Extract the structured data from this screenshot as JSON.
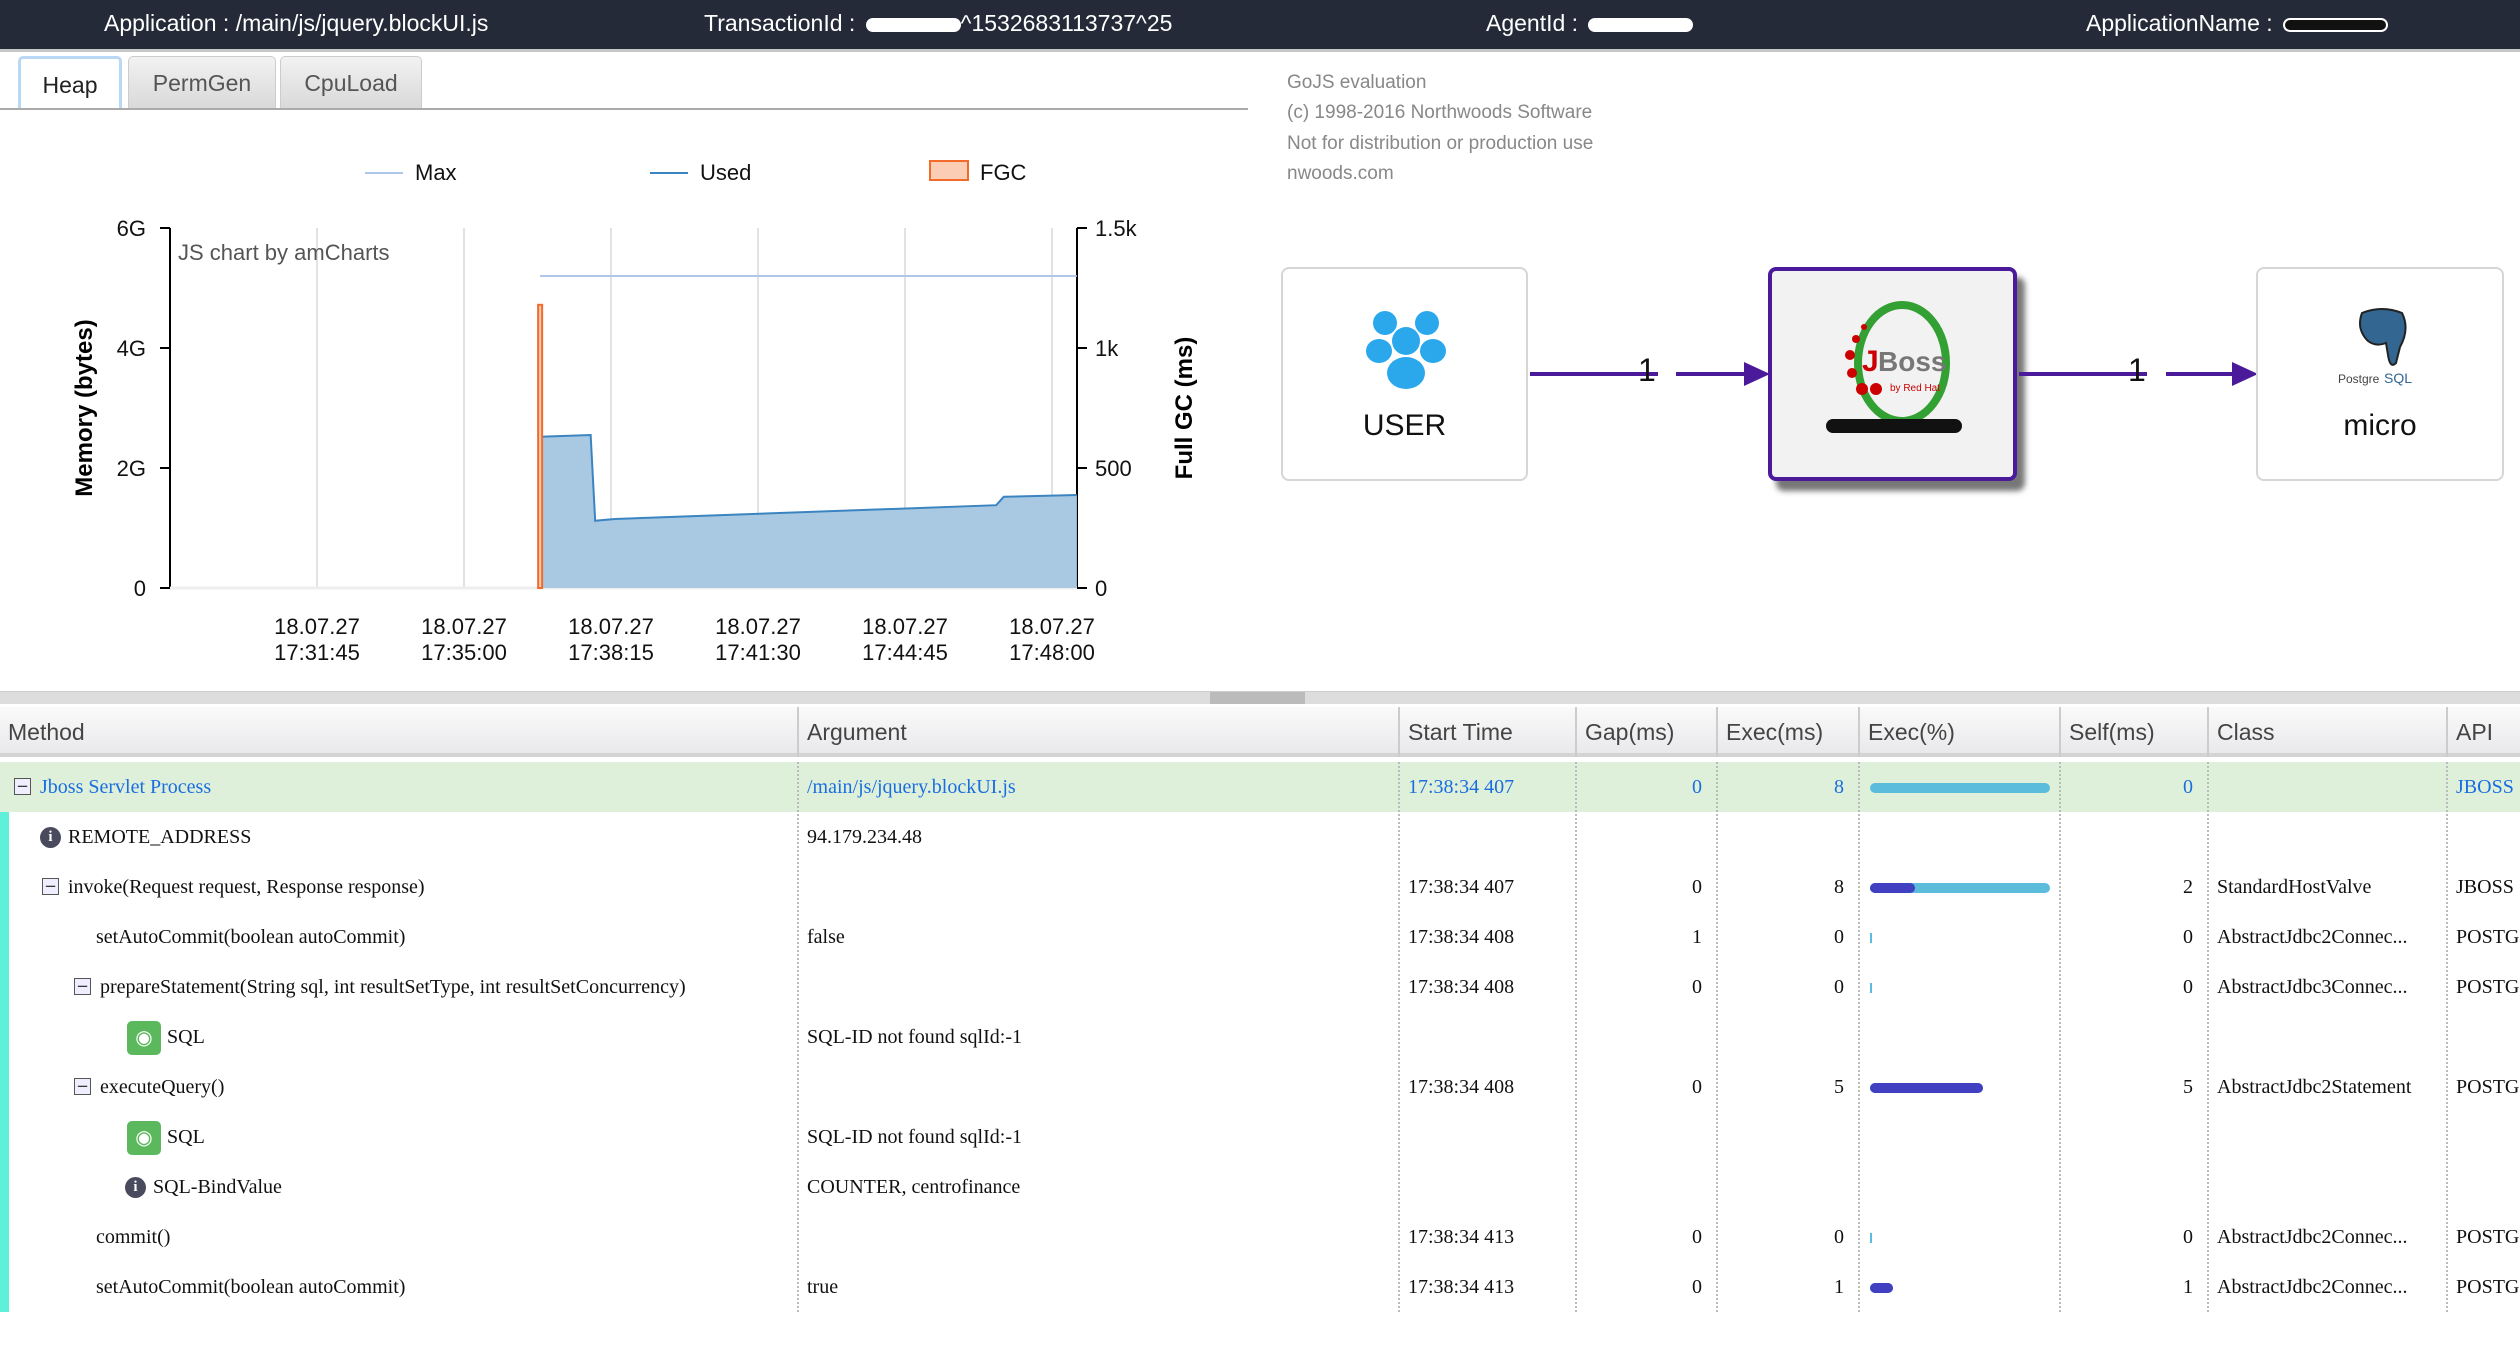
{
  "header": {
    "application_label": "Application : ",
    "application": "/main/js/jquery.blockUI.js",
    "transaction_label": "TransactionId : ",
    "transaction": "^1532683113737^25",
    "agent_label": "AgentId : ",
    "appname_label": "ApplicationName : "
  },
  "tabs": [
    {
      "label": "Heap",
      "active": true
    },
    {
      "label": "PermGen"
    },
    {
      "label": "CpuLoad"
    }
  ],
  "chart_data": {
    "type": "area",
    "watermark": "JS chart by amCharts",
    "ylabel": "Memory (bytes)",
    "y2label": "Full GC (ms)",
    "y_ticks": [
      "0",
      "2G",
      "4G",
      "6G"
    ],
    "y_range_gb": [
      0,
      6
    ],
    "y2_ticks": [
      "0",
      "500",
      "1k",
      "1.5k"
    ],
    "y2_range": [
      0,
      1500
    ],
    "x_ticks": [
      {
        "date": "18.07.27",
        "time": "17:31:45"
      },
      {
        "date": "18.07.27",
        "time": "17:35:00"
      },
      {
        "date": "18.07.27",
        "time": "17:38:15"
      },
      {
        "date": "18.07.27",
        "time": "17:41:30"
      },
      {
        "date": "18.07.27",
        "time": "17:44:45"
      },
      {
        "date": "18.07.27",
        "time": "17:48:00"
      }
    ],
    "grid": true,
    "legend_position": "top",
    "series": [
      {
        "name": "Max",
        "color": "#aec7e8",
        "type": "line",
        "points": [
          [
            "17:36:41",
            5.2
          ],
          [
            "17:48:33",
            5.2
          ]
        ]
      },
      {
        "name": "Used",
        "color": "#3a84c1",
        "fill": "#a9c9e2",
        "type": "area",
        "points": [
          [
            "17:36:41",
            2.52
          ],
          [
            "17:37:48",
            2.55
          ],
          [
            "17:37:54",
            1.12
          ],
          [
            "17:38:20",
            1.15
          ],
          [
            "17:46:46",
            1.38
          ],
          [
            "17:46:56",
            1.52
          ],
          [
            "17:48:33",
            1.55
          ]
        ]
      },
      {
        "name": "FGC",
        "color": "#f26b2a",
        "fill": "#fbcdb5",
        "type": "bar",
        "points": [
          [
            "17:36:41",
            1180
          ]
        ]
      }
    ]
  },
  "gojs_notice": [
    "GoJS evaluation",
    "(c) 1998-2016 Northwoods Software",
    "Not for distribution or production use",
    "nwoods.com"
  ],
  "diagram": {
    "nodes": [
      {
        "label": "USER",
        "icon": "users-icon"
      },
      {
        "label": "",
        "icon": "jboss-logo"
      },
      {
        "label": "micro",
        "icon": "postgresql-logo"
      }
    ],
    "edges": [
      {
        "label": "1"
      },
      {
        "label": "1"
      }
    ],
    "accent": "#4b1a9a"
  },
  "table": {
    "columns": [
      "Method",
      "Argument",
      "Start Time",
      "Gap(ms)",
      "Exec(ms)",
      "Exec(%)",
      "Self(ms)",
      "Class",
      "API"
    ],
    "rows": [
      {
        "method": "Jboss Servlet Process",
        "toggle": "−",
        "level": 0,
        "argument": "/main/js/jquery.blockUI.js",
        "start": "17:38:34 407",
        "gap": "0",
        "exec": "8",
        "exec_pct": 100,
        "self_pct": 0,
        "self": "0",
        "class": "",
        "api": "JBOSS",
        "highlight": true
      },
      {
        "method": "REMOTE_ADDRESS",
        "icon": "info",
        "level": 1,
        "argument": "94.179.234.48"
      },
      {
        "method": "invoke(Request request, Response response)",
        "toggle": "−",
        "level": 1,
        "argument": "",
        "start": "17:38:34 407",
        "gap": "0",
        "exec": "8",
        "exec_pct": 100,
        "self_pct": 25,
        "self": "2",
        "class": "StandardHostValve",
        "api": "JBOSS"
      },
      {
        "method": "setAutoCommit(boolean autoCommit)",
        "level": 2,
        "argument": "false",
        "start": "17:38:34 408",
        "gap": "1",
        "exec": "0",
        "exec_pct": 0,
        "self_pct": 0,
        "self": "0",
        "class": "AbstractJdbc2Connec...",
        "api": "POSTGRESQL"
      },
      {
        "method": "prepareStatement(String sql, int resultSetType, int resultSetConcurrency)",
        "toggle": "−",
        "level": 2,
        "argument": "",
        "start": "17:38:34 408",
        "gap": "0",
        "exec": "0",
        "exec_pct": 0,
        "self_pct": 0,
        "self": "0",
        "class": "AbstractJdbc3Connec...",
        "api": "POSTGRESQL"
      },
      {
        "method": "SQL",
        "icon": "eye",
        "level": 3,
        "argument": "SQL-ID not found sqlId:-1"
      },
      {
        "method": "executeQuery()",
        "toggle": "−",
        "level": 2,
        "argument": "",
        "start": "17:38:34 408",
        "gap": "0",
        "exec": "5",
        "exec_pct": 62.5,
        "self_pct": 62.5,
        "self": "5",
        "class": "AbstractJdbc2Statement",
        "api": "POSTGRESQL"
      },
      {
        "method": "SQL",
        "icon": "eye",
        "level": 3,
        "argument": "SQL-ID not found sqlId:-1"
      },
      {
        "method": "SQL-BindValue",
        "icon": "info",
        "level": 3,
        "argument": "COUNTER, centrofinance"
      },
      {
        "method": "commit()",
        "level": 2,
        "argument": "",
        "start": "17:38:34 413",
        "gap": "0",
        "exec": "0",
        "exec_pct": 0,
        "self_pct": 0,
        "self": "0",
        "class": "AbstractJdbc2Connec...",
        "api": "POSTGRESQL"
      },
      {
        "method": "setAutoCommit(boolean autoCommit)",
        "level": 2,
        "argument": "true",
        "start": "17:38:34 413",
        "gap": "0",
        "exec": "1",
        "exec_pct": 12.5,
        "self_pct": 12.5,
        "self": "1",
        "class": "AbstractJdbc2Connec...",
        "api": "POSTGRESQL"
      }
    ]
  }
}
